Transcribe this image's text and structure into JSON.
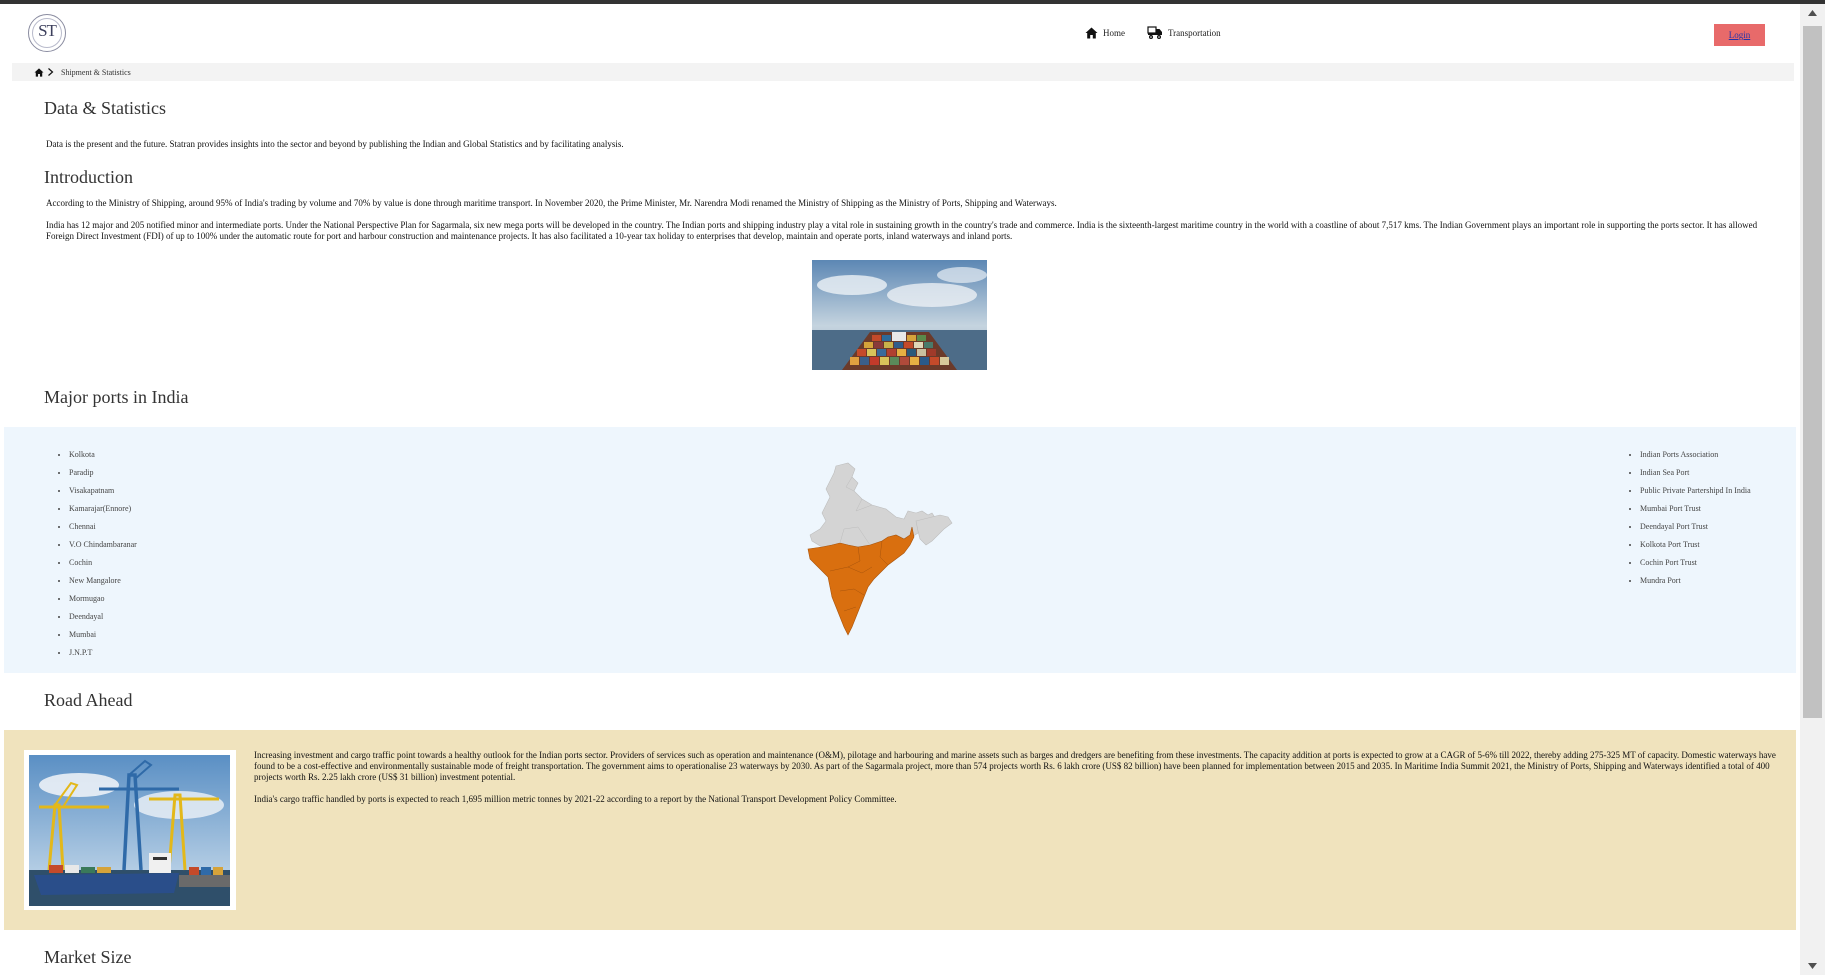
{
  "header": {
    "logo_text": "ST",
    "nav": [
      {
        "label": "Home",
        "icon": "home-icon"
      },
      {
        "label": "Transportation",
        "icon": "truck-icon"
      }
    ],
    "login_label": "Login"
  },
  "breadcrumb": {
    "current": "Shipment & Statistics"
  },
  "sections": {
    "data_stats": {
      "title": "Data & Statistics",
      "text": "Data is the present and the future. Statran provides insights into the sector and beyond by publishing the Indian and Global Statistics and by facilitating analysis."
    },
    "introduction": {
      "title": "Introduction",
      "p1": "According to the Ministry of Shipping, around 95% of India's trading by volume and 70% by value is done through maritime transport. In November 2020, the Prime Minister, Mr. Narendra Modi renamed the Ministry of Shipping as the Ministry of Ports, Shipping and Waterways.",
      "p2": "India has 12 major and 205 notified minor and intermediate ports. Under the National Perspective Plan for Sagarmala, six new mega ports will be developed in the country. The Indian ports and shipping industry play a vital role in sustaining growth in the country's trade and commerce. India is the sixteenth-largest maritime country in the world with a coastline of about 7,517 kms. The Indian Government plays an important role in supporting the ports sector. It has allowed Foreign Direct Investment (FDI) of up to 100% under the automatic route for port and harbour construction and maintenance projects. It has also facilitated a 10-year tax holiday to enterprises that develop, maintain and operate ports, inland waterways and inland ports."
    },
    "major_ports": {
      "title": "Major ports in India",
      "ports": [
        "Kolkota",
        "Paradip",
        "Visakapatnam",
        "Kamarajar(Ennore)",
        "Chennai",
        "V.O Chindambaranar",
        "Cochin",
        "New Mangalore",
        "Mormugao",
        "Deendayal",
        "Mumbai",
        "J.N.P.T"
      ],
      "links": [
        "Indian Ports Association",
        "Indian Sea Port",
        "Public Private Partershipd In India",
        "Mumbai Port Trust",
        "Deendayal Port Trust",
        "Kolkota Port Trust",
        "Cochin Port Trust",
        "Mundra Port"
      ]
    },
    "road_ahead": {
      "title": "Road Ahead",
      "p1": "Increasing investment and cargo traffic point towards a healthy outlook for the Indian ports sector. Providers of services such as operation and maintenance (O&M), pilotage and harbouring and marine assets such as barges and dredgers are benefiting from these investments. The capacity addition at ports is expected to grow at a CAGR of 5-6% till 2022, thereby adding 275-325 MT of capacity. Domestic waterways have found to be a cost-effective and environmentally sustainable mode of freight transportation. The government aims to operationalise 23 waterways by 2030. As part of the Sagarmala project, more than 574 projects worth Rs. 6 lakh crore (US$ 82 billion) have been planned for implementation between 2015 and 2035. In Maritime India Summit 2021, the Ministry of Ports, Shipping and Waterways identified a total of 400 projects worth Rs. 2.25 lakh crore (US$ 31 billion) investment potential.",
      "p2": "India's cargo traffic handled by ports is expected to reach 1,695 million metric tonnes by 2021-22 according to a report by the National Transport Development Policy Committee."
    },
    "market_size": {
      "title": "Market Size"
    }
  },
  "colors": {
    "map_highlight": "#d96f0f",
    "map_base": "#d4d4d4",
    "ports_band": "#eef6fd",
    "road_band": "#f0e3bd",
    "login_bg": "#e86a6a"
  }
}
